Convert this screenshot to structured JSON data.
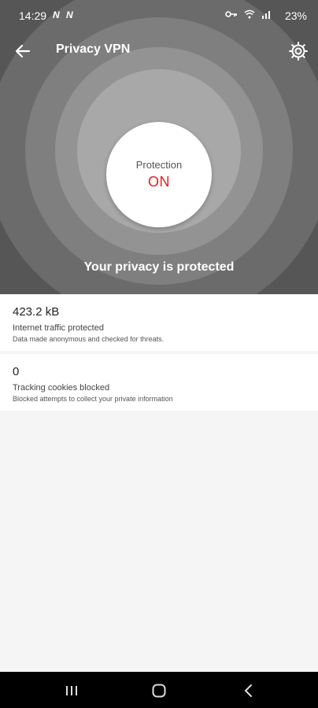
{
  "status_bar": {
    "time": "14:29",
    "notif1": "N",
    "notif2": "N",
    "battery": "23%",
    "icons": [
      "vpn-key-icon",
      "wifi-icon",
      "signal-icon"
    ]
  },
  "toolbar": {
    "title": "Privacy VPN",
    "back_icon": "arrow-left-icon",
    "settings_icon": "gear-icon"
  },
  "protection": {
    "label": "Protection",
    "state": "ON",
    "state_color": "#e02020",
    "message": "Your privacy is protected"
  },
  "stats": [
    {
      "value": "423.2 kB",
      "label": "Internet traffic protected",
      "description": "Data made anonymous and checked for threats."
    },
    {
      "value": "0",
      "label": "Tracking cookies blocked",
      "description": "Blocked attempts to collect your private information"
    }
  ],
  "nav_bar": {
    "icons": [
      "recents-icon",
      "home-icon",
      "back-icon"
    ]
  }
}
